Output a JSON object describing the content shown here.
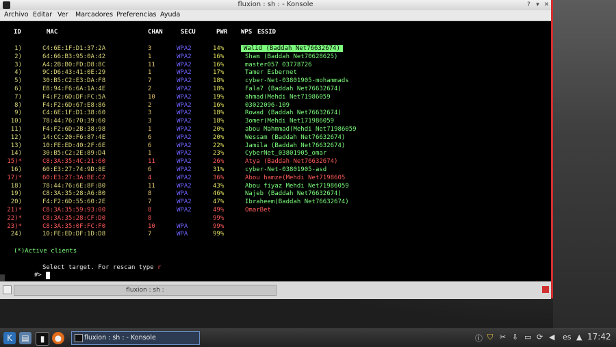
{
  "window": {
    "title": "fluxion : sh : - Konsole",
    "menu": [
      "Archivo",
      "Editar",
      "Ver",
      "Marcadores",
      "Preferencias",
      "Ayuda"
    ]
  },
  "columns": {
    "id": "ID",
    "mac": "MAC",
    "chan": "CHAN",
    "secu": "SECU",
    "pwr": "PWR",
    "wps": "WPS",
    "essid": "ESSID"
  },
  "networks": [
    {
      "id": "1)",
      "mac": "C4:6E:1F:D1:37:2A",
      "chan": "3",
      "secu": "WPA2",
      "pwr": "14%",
      "essid": "Walid (Baddah Net76632674)",
      "active": false,
      "selected": true
    },
    {
      "id": "2)",
      "mac": "64:66:B3:95:0A:42",
      "chan": "1",
      "secu": "WPA2",
      "pwr": "16%",
      "essid": "Sham (Baddah Net70628625)",
      "active": false
    },
    {
      "id": "3)",
      "mac": "A4:2B:B0:FD:D8:8C",
      "chan": "11",
      "secu": "WPA2",
      "pwr": "16%",
      "essid": "master057 03778726",
      "active": false
    },
    {
      "id": "4)",
      "mac": "9C:D6:43:41:0E:29",
      "chan": "1",
      "secu": "WPA2",
      "pwr": "17%",
      "essid": "Tamer Esbernet",
      "active": false
    },
    {
      "id": "5)",
      "mac": "30:B5:C2:E3:DA:F8",
      "chan": "7",
      "secu": "WPA2",
      "pwr": "18%",
      "essid": "cyber-Net-03801905-mohammads",
      "active": false
    },
    {
      "id": "6)",
      "mac": "E8:94:F6:6A:1A:4E",
      "chan": "2",
      "secu": "WPA2",
      "pwr": "18%",
      "essid": "Fala7 (Baddah Net76632674)",
      "active": false
    },
    {
      "id": "7)",
      "mac": "F4:F2:6D:DF:FC:5A",
      "chan": "10",
      "secu": "WPA2",
      "pwr": "19%",
      "essid": "ahmad(Mehdi Net71986059",
      "active": false
    },
    {
      "id": "8)",
      "mac": "F4:F2:6D:67:E8:86",
      "chan": "2",
      "secu": "WPA2",
      "pwr": "16%",
      "essid": "03022096-109",
      "active": false
    },
    {
      "id": "9)",
      "mac": "C4:6E:1F:D1:38:60",
      "chan": "3",
      "secu": "WPA2",
      "pwr": "18%",
      "essid": "Rowad (Baddah Net76632674)",
      "active": false
    },
    {
      "id": "10)",
      "mac": "78:44:76:70:39:60",
      "chan": "3",
      "secu": "WPA2",
      "pwr": "18%",
      "essid": "3omer(Mehdi Net171986059",
      "active": false
    },
    {
      "id": "11)",
      "mac": "F4:F2:6D:2B:38:98",
      "chan": "1",
      "secu": "WPA2",
      "pwr": "20%",
      "essid": "abou Mahmmad(Mehdi Net71986059",
      "active": false
    },
    {
      "id": "12)",
      "mac": "14:CC:20:F6:87:4E",
      "chan": "6",
      "secu": "WPA2",
      "pwr": "20%",
      "essid": "Wessam (Baddah Net76632674)",
      "active": false
    },
    {
      "id": "13)",
      "mac": "10:FE:ED:40:2F:6E",
      "chan": "6",
      "secu": "WPA2",
      "pwr": "22%",
      "essid": "Jamila (Baddah Net76632674)",
      "active": false
    },
    {
      "id": "14)",
      "mac": "30:B5:C2:2E:89:D4",
      "chan": "1",
      "secu": "WPA2",
      "pwr": "23%",
      "essid": "CyberNet_03801905_omar",
      "active": false
    },
    {
      "id": "15)*",
      "mac": "C8:3A:35:4C:21:60",
      "chan": "11",
      "secu": "WPA2",
      "pwr": "26%",
      "essid": "Atya (Baddah Net76632674)",
      "active": true
    },
    {
      "id": "16)",
      "mac": "60:E3:27:74:9D:8E",
      "chan": "6",
      "secu": "WPA2",
      "pwr": "31%",
      "essid": "cyber-Net-03801905-asd",
      "active": false
    },
    {
      "id": "17)*",
      "mac": "60:E3:27:3A:BE:C2",
      "chan": "4",
      "secu": "WPA2",
      "pwr": "36%",
      "essid": "Abou hamze(Mehdi Net7198605",
      "active": true
    },
    {
      "id": "18)",
      "mac": "78:44:76:6E:8F:B0",
      "chan": "11",
      "secu": "WPA2",
      "pwr": "43%",
      "essid": "Abou fiyaz Mehdi Net71986059",
      "active": false
    },
    {
      "id": "19)",
      "mac": "C8:3A:35:28:A6:B0",
      "chan": "8",
      "secu": "WPA",
      "pwr": "46%",
      "essid": "Najeb (Baddah Net76632674)",
      "active": false
    },
    {
      "id": "20)",
      "mac": "F4:F2:6D:55:60:2E",
      "chan": "7",
      "secu": "WPA2",
      "pwr": "47%",
      "essid": "Ibraheem(Baddah Net76632674)",
      "active": false
    },
    {
      "id": "21)*",
      "mac": "C8:3A:35:59:93:00",
      "chan": "8",
      "secu": "WPA2",
      "pwr": "49%",
      "essid": "OmarBet",
      "active": true
    },
    {
      "id": "22)*",
      "mac": "C8:3A:35:28:CF:D0",
      "chan": "8",
      "secu": "",
      "pwr": "99%",
      "essid": "",
      "active": true
    },
    {
      "id": "23)*",
      "mac": "C8:3A:35:0F:FC:F0",
      "chan": "10",
      "secu": "WPA",
      "pwr": "99%",
      "essid": "",
      "active": true
    },
    {
      "id": "24)",
      "mac": "10:FE:ED:DF:1D:D8",
      "chan": "7",
      "secu": "WPA",
      "pwr": "99%",
      "essid": "",
      "active": false
    }
  ],
  "footer": {
    "active_clients": "(*)Active clients",
    "prompt_text": "Select target. For rescan type ",
    "rescan_key": "r",
    "shell_prompt": "#>"
  },
  "tab": {
    "label": "fluxion : sh :"
  },
  "taskbar": {
    "task_label": "fluxion : sh : - Konsole",
    "lang": "es",
    "clock": "17:42"
  },
  "colors": {
    "selected_bg": "#7dff7d",
    "active_row": "#ff5a5a",
    "secu": "#6f63ff",
    "window_border": "#d23030"
  }
}
